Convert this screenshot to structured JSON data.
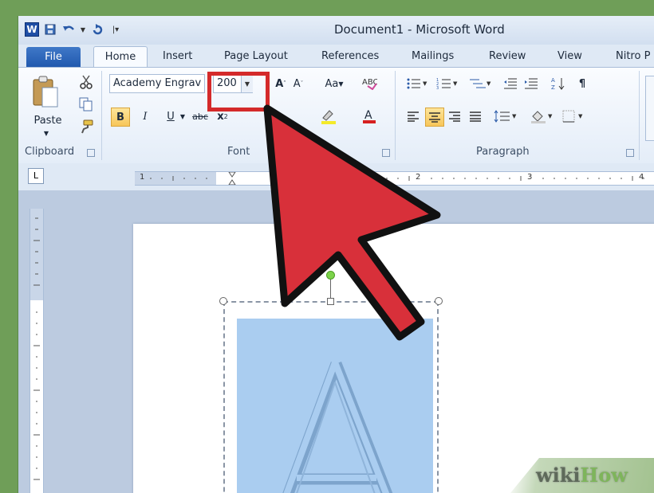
{
  "window": {
    "title": "Document1 - Microsoft Word"
  },
  "quick_access": {
    "icons": [
      "word-icon",
      "save-icon",
      "undo-icon",
      "redo-icon",
      "customize-icon"
    ]
  },
  "tabs": [
    {
      "label": "File"
    },
    {
      "label": "Home"
    },
    {
      "label": "Insert"
    },
    {
      "label": "Page Layout"
    },
    {
      "label": "References"
    },
    {
      "label": "Mailings"
    },
    {
      "label": "Review"
    },
    {
      "label": "View"
    },
    {
      "label": "Nitro P"
    }
  ],
  "ribbon": {
    "clipboard": {
      "label": "Clipboard",
      "paste_label": "Paste"
    },
    "font": {
      "label": "Font",
      "font_name": "Academy Engrav",
      "font_size": "200",
      "case_label": "Aa"
    },
    "paragraph": {
      "label": "Paragraph"
    }
  },
  "ruler": {
    "marks": [
      "1",
      "2",
      "3",
      "4"
    ]
  },
  "document": {
    "textbox_letter": "A"
  },
  "watermark": {
    "wiki": "wiki",
    "how": "How"
  },
  "colors": {
    "highlight": "#d42a2a",
    "arrow": "#d8303a",
    "textbox_fill": "#aacdf0"
  }
}
